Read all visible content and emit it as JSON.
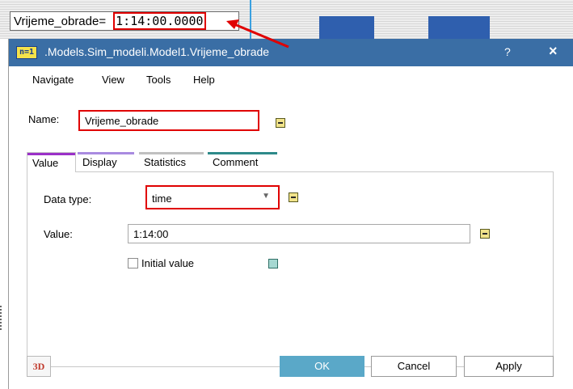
{
  "tooltip": {
    "name": "Vrijeme_obrade=",
    "value": "1:14:00.0000"
  },
  "titlebar": {
    "icon_text": "n=1",
    "title": ".Models.Sim_modeli.Model1.Vrijeme_obrade",
    "help": "?",
    "close": "×"
  },
  "menu": [
    "Navigate",
    "View",
    "Tools",
    "Help"
  ],
  "name_field": {
    "label": "Name:",
    "value": "Vrijeme_obrade"
  },
  "tabs": [
    {
      "label": "Value",
      "color": "#9b30c8"
    },
    {
      "label": "Display",
      "color": "#a98be0"
    },
    {
      "label": "Statistics",
      "color": "#c0c0c0"
    },
    {
      "label": "Comment",
      "color": "#2e8a8a"
    }
  ],
  "value_tab": {
    "data_type_label": "Data type:",
    "data_type_value": "time",
    "value_label": "Value:",
    "value": "1:14:00",
    "initial_value_label": "Initial value"
  },
  "buttons": {
    "three_d": "3D",
    "ok": "OK",
    "cancel": "Cancel",
    "apply": "Apply"
  },
  "colors": {
    "titlebar": "#3a6ea5",
    "highlight": "#e00000",
    "ok_button": "#5aa8c8"
  }
}
